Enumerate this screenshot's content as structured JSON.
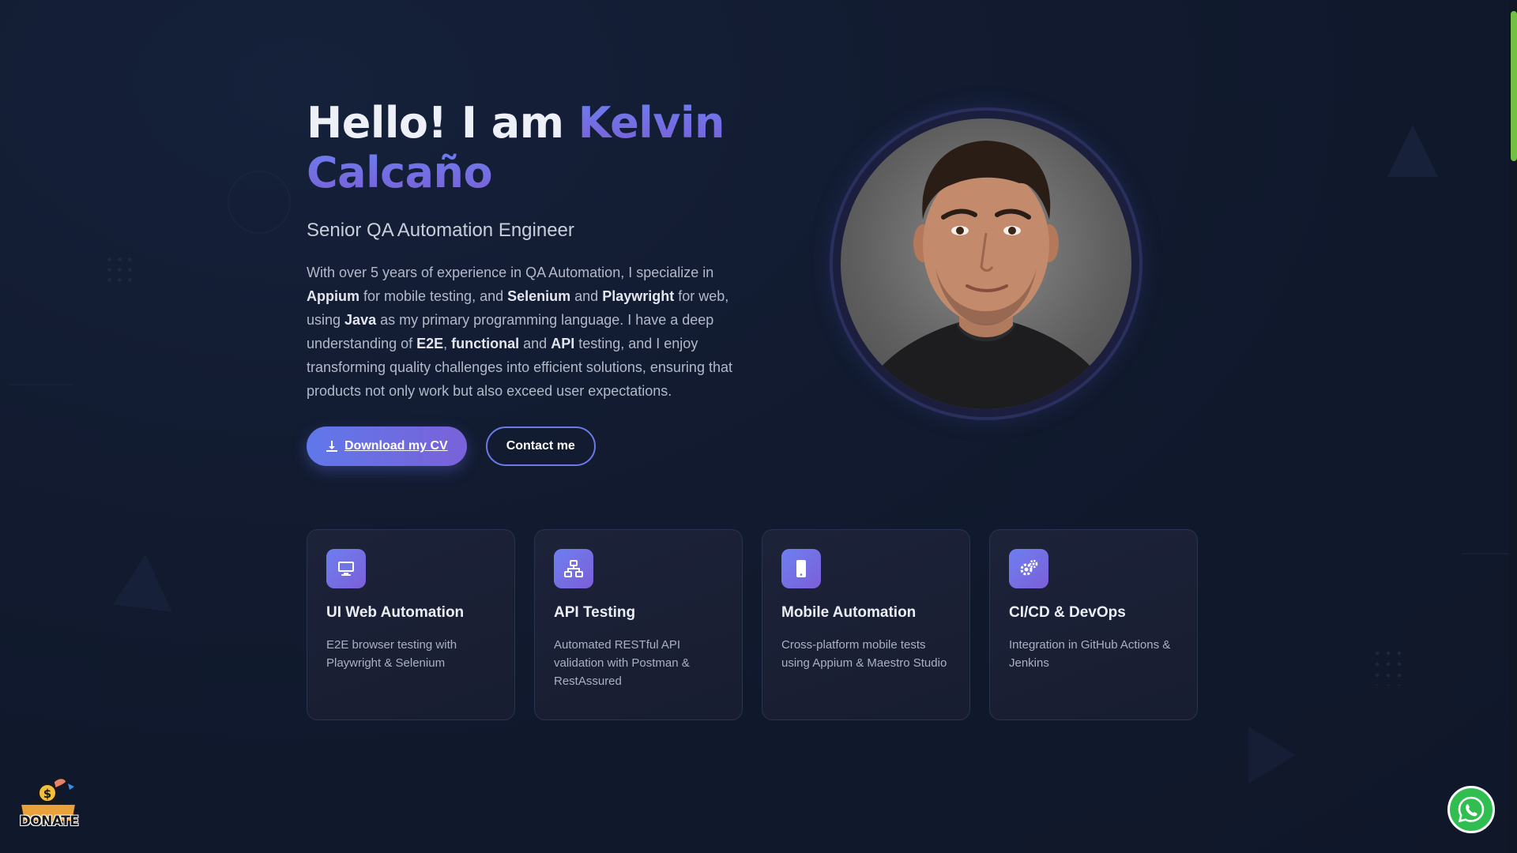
{
  "hero": {
    "greeting": "Hello! I am ",
    "name": "Kelvin Calcaño",
    "subtitle": "Senior QA Automation Engineer",
    "description": {
      "p1": "With over 5 years of experience in QA Automation, I specialize in ",
      "b1": "Appium",
      "p2": " for mobile testing, and ",
      "b2": "Selenium",
      "p3": " and ",
      "b3": "Playwright",
      "p4": " for web, using ",
      "b4": "Java",
      "p5": " as my primary programming language. I have a deep understanding of ",
      "b5": "E2E",
      "p6": ", ",
      "b6": "functional",
      "p7": " and ",
      "b7": "API",
      "p8": " testing, and I enjoy transforming quality challenges into efficient solutions, ensuring that products not only work but also exceed user expectations."
    },
    "download_cv_label": "Download my CV",
    "contact_label": "Contact me"
  },
  "cards": [
    {
      "icon": "monitor-icon",
      "title": "UI Web Automation",
      "desc": "E2E browser testing with Playwright & Selenium"
    },
    {
      "icon": "network-icon",
      "title": "API Testing",
      "desc": "Automated RESTful API validation with Postman & RestAssured"
    },
    {
      "icon": "mobile-icon",
      "title": "Mobile Automation",
      "desc": "Cross-platform mobile tests using Appium & Maestro Studio"
    },
    {
      "icon": "gears-icon",
      "title": "CI/CD & DevOps",
      "desc": "Integration in GitHub Actions & Jenkins"
    }
  ],
  "widgets": {
    "donate_label": "DONATE",
    "whatsapp_icon": "whatsapp-icon"
  },
  "colors": {
    "background": "#111a2e",
    "accent_start": "#5f78ea",
    "accent_end": "#7a62d9",
    "scrollbar_thumb": "#74c043",
    "whatsapp": "#2fbe4f"
  }
}
